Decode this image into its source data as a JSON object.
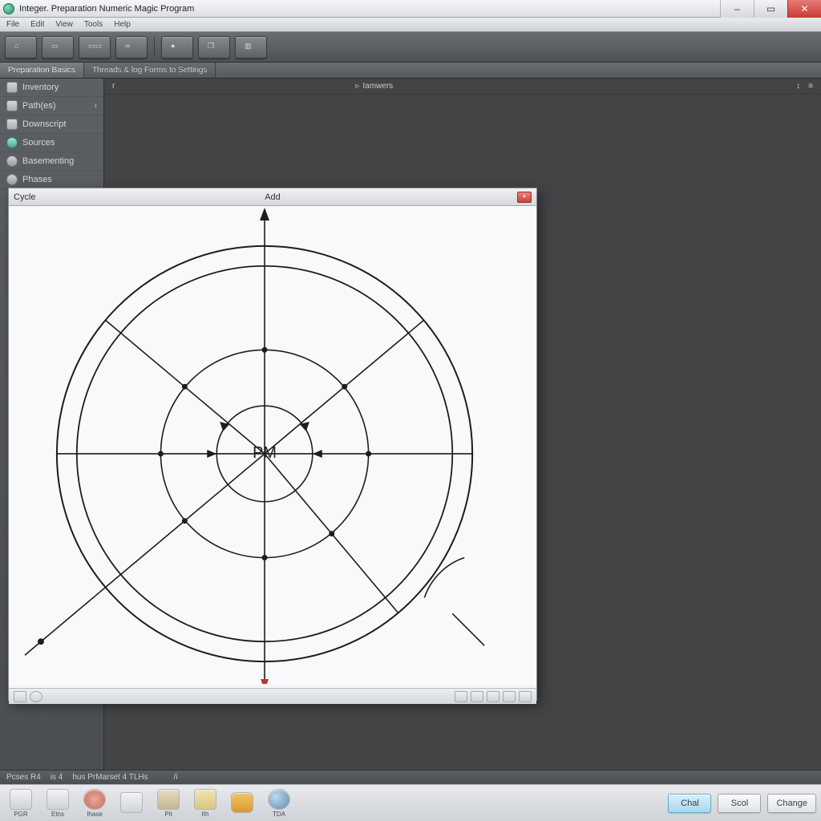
{
  "window": {
    "title": "Integer. Preparation Numeric Magic Program",
    "minimize_label": "–",
    "maximize_label": "▭",
    "close_label": "✕"
  },
  "menu": {
    "items": [
      "File",
      "Edit",
      "View",
      "Tools",
      "Help"
    ]
  },
  "toolbar": {
    "buttons": [
      {
        "name": "home-icon",
        "glyph": "⌂"
      },
      {
        "name": "screen-icon",
        "glyph": "▭"
      },
      {
        "name": "screens-icon",
        "glyph": "▭▭"
      },
      {
        "name": "link-icon",
        "glyph": "∞"
      },
      {
        "name": "record-icon",
        "glyph": "●"
      },
      {
        "name": "window-icon",
        "glyph": "❐"
      },
      {
        "name": "panel-icon",
        "glyph": "▥"
      }
    ]
  },
  "tabs": [
    {
      "label": "Preparation Basics",
      "active": true
    },
    {
      "label": "Threads & log Forms to Settings",
      "active": false
    }
  ],
  "sidebar": {
    "items": [
      {
        "label": "Inventory",
        "icon": "box",
        "variant": ""
      },
      {
        "label": "Path(es)",
        "icon": "doc",
        "variant": "",
        "caret": true
      },
      {
        "label": "Downscript",
        "icon": "disk",
        "variant": ""
      },
      {
        "label": "Sources",
        "icon": "orb",
        "variant": "alt"
      },
      {
        "label": "Basementing",
        "icon": "gear",
        "variant": "grey"
      },
      {
        "label": "Phases",
        "icon": "ring",
        "variant": "grey"
      }
    ]
  },
  "workspace": {
    "header_mark": "r",
    "header_label": "Iamwers",
    "right_glyph": "↕"
  },
  "diagram": {
    "title_left": "Cycle",
    "title_center": "Add",
    "center_label": "PM",
    "close_glyph": "•"
  },
  "infostrip": {
    "left": "Pcses R4",
    "mid1": "is 4",
    "mid2": "hus   PrMarset 4 TLHs",
    "mark": "/i"
  },
  "taskbar": {
    "items": [
      {
        "label": "PGR",
        "color": "#d6d8db"
      },
      {
        "label": "Etns",
        "color": "#e7d6b6"
      },
      {
        "label": "Ihase",
        "color": "#d87d6d"
      },
      {
        "label": "",
        "color": "#e4e6e8"
      },
      {
        "label": "Pit",
        "color": "#c7b89a"
      },
      {
        "label": "Ith",
        "color": "#ead9a2"
      },
      {
        "label": "",
        "color": "#e9b04f"
      },
      {
        "label": "TDA",
        "color": "#7aa8c9"
      }
    ],
    "buttons": [
      {
        "label": "Chal",
        "accent": true
      },
      {
        "label": "Scol",
        "accent": false
      },
      {
        "label": "Change",
        "accent": false
      }
    ]
  },
  "chart_data": {
    "type": "diagram",
    "title": "Add",
    "center_label": "PM",
    "rings": [
      60,
      130,
      235,
      260
    ],
    "spokes_deg": [
      0,
      40,
      90,
      140,
      180,
      220,
      270,
      320
    ],
    "annotations": [
      "vertical axis arrow up",
      "vertical axis arrow down",
      "diagonal tick at ~300°",
      "small arc at ~330°"
    ]
  }
}
